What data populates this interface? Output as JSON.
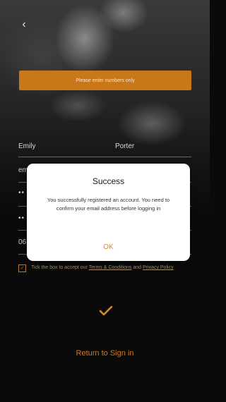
{
  "banner": {
    "text": "Please enter numbers only"
  },
  "form": {
    "first_name": "Emily",
    "last_name": "Porter",
    "email_fragment": "em",
    "password_mask": "••",
    "confirm_mask": "••",
    "date_fragment": "06"
  },
  "terms": {
    "prefix": "Tick the box to accept our ",
    "terms_link": "Terms & Conditions",
    "and": " and ",
    "privacy_link": "Privacy Policy"
  },
  "actions": {
    "return_label": "Return to Sign in"
  },
  "dialog": {
    "title": "Success",
    "message": "You successfully registered an account. You need to confirm your email address before logging in",
    "ok_label": "OK"
  },
  "colors": {
    "accent": "#c97819",
    "link": "#d07a1c",
    "dialog_ok": "#d98b2b"
  },
  "icons": {
    "back": "chevron-left-icon",
    "submit": "checkmark-icon"
  }
}
